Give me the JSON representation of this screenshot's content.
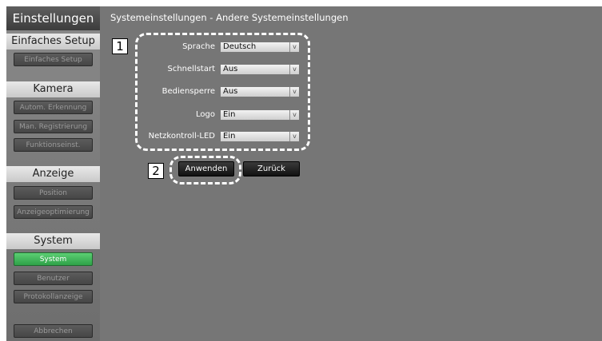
{
  "sidebar": {
    "header": "Einstellungen",
    "sections": [
      {
        "title": "Einfaches Setup",
        "items": [
          {
            "label": "Einfaches Setup"
          }
        ]
      },
      {
        "title": "Kamera",
        "items": [
          {
            "label": "Autom. Erkennung"
          },
          {
            "label": "Man. Registrierung"
          },
          {
            "label": "Funktionseinst."
          }
        ]
      },
      {
        "title": "Anzeige",
        "items": [
          {
            "label": "Position"
          },
          {
            "label": "Anzeigeoptimierung"
          }
        ]
      },
      {
        "title": "System",
        "items": [
          {
            "label": "System"
          },
          {
            "label": "Benutzer"
          },
          {
            "label": "Protokollanzeige"
          }
        ]
      }
    ],
    "cancel_label": "Abbrechen",
    "active_color": "#3db858"
  },
  "main": {
    "title": "Systemeinstellungen - Andere Systemeinstellungen",
    "settings": [
      {
        "label": "Sprache",
        "value": "Deutsch"
      },
      {
        "label": "Schnellstart",
        "value": "Aus"
      },
      {
        "label": "Bediensperre",
        "value": "Aus"
      },
      {
        "label": "Logo",
        "value": "Ein"
      },
      {
        "label": "Netzkontroll-LED",
        "value": "Ein"
      }
    ],
    "apply_label": "Anwenden",
    "back_label": "Zurück",
    "callouts": [
      "1",
      "2"
    ],
    "select_arrow": "v"
  }
}
